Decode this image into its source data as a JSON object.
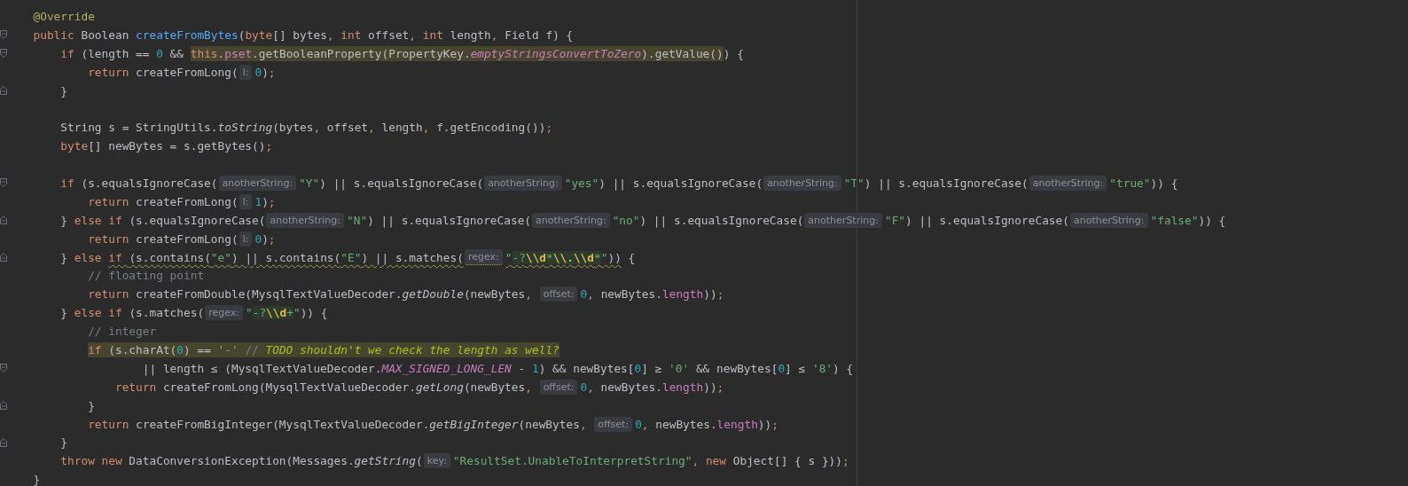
{
  "editor": {
    "lines": [
      {
        "kind": "code",
        "segs": [
          {
            "kind": "code",
            "tokens": [
              {
                "kind": "annotation",
                "text": "@Override"
              }
            ]
          }
        ]
      },
      {
        "kind": "code",
        "fold_start": true,
        "segs": [
          {
            "kind": "code",
            "tokens": [
              {
                "kind": "keyword",
                "text": "public "
              },
              {
                "kind": "plain",
                "text": "Boolean "
              },
              {
                "kind": "decl",
                "text": "createFromBytes"
              },
              {
                "kind": "plain",
                "text": "("
              },
              {
                "kind": "keyword",
                "text": "byte"
              },
              {
                "kind": "plain",
                "text": "[] bytes"
              },
              {
                "kind": "keyword",
                "text": ", int "
              },
              {
                "kind": "plain",
                "text": "offset"
              },
              {
                "kind": "keyword",
                "text": ", int "
              },
              {
                "kind": "plain",
                "text": "length"
              },
              {
                "kind": "keyword",
                "text": ", "
              },
              {
                "kind": "plain",
                "text": "Field f) {"
              }
            ]
          }
        ]
      },
      {
        "kind": "code",
        "fold_start": true,
        "segs": [
          {
            "kind": "code",
            "tokens": [
              {
                "kind": "keyword",
                "text": "    if "
              },
              {
                "kind": "plain",
                "text": "(length == "
              },
              {
                "kind": "number",
                "text": "0"
              },
              {
                "kind": "plain",
                "text": " && "
              }
            ]
          },
          {
            "kind": "match",
            "tokens": [
              {
                "kind": "keyword",
                "text": "this"
              },
              {
                "kind": "plain",
                "text": "."
              },
              {
                "kind": "field",
                "text": "pset"
              },
              {
                "kind": "plain",
                "text": ".getBooleanProperty(PropertyKey."
              },
              {
                "kind": "sfield",
                "text": "emptyStringsConvertToZero"
              },
              {
                "kind": "plain",
                "text": ").getValue()"
              }
            ]
          },
          {
            "kind": "code",
            "tokens": [
              {
                "kind": "plain",
                "text": ") {"
              }
            ]
          }
        ]
      },
      {
        "kind": "code",
        "segs": [
          {
            "kind": "code",
            "tokens": [
              {
                "kind": "keyword",
                "text": "        return "
              },
              {
                "kind": "plain",
                "text": "createFromLong("
              }
            ]
          },
          {
            "kind": "hint",
            "text": "l:"
          },
          {
            "kind": "code",
            "tokens": [
              {
                "kind": "number",
                "text": "0"
              },
              {
                "kind": "plain",
                "text": ")"
              },
              {
                "kind": "keyword",
                "text": ";"
              }
            ]
          }
        ]
      },
      {
        "kind": "code",
        "fold_end": true,
        "segs": [
          {
            "kind": "code",
            "tokens": [
              {
                "kind": "plain",
                "text": "    }"
              }
            ]
          }
        ]
      },
      {
        "kind": "blank"
      },
      {
        "kind": "code",
        "segs": [
          {
            "kind": "code",
            "tokens": [
              {
                "kind": "plain",
                "text": "    String s = StringUtils."
              },
              {
                "kind": "scall",
                "text": "toString"
              },
              {
                "kind": "plain",
                "text": "(bytes"
              },
              {
                "kind": "keyword",
                "text": ", "
              },
              {
                "kind": "plain",
                "text": "offset"
              },
              {
                "kind": "keyword",
                "text": ", "
              },
              {
                "kind": "plain",
                "text": "length"
              },
              {
                "kind": "keyword",
                "text": ", "
              },
              {
                "kind": "plain",
                "text": "f.getEncoding())"
              },
              {
                "kind": "keyword",
                "text": ";"
              }
            ]
          }
        ]
      },
      {
        "kind": "code",
        "segs": [
          {
            "kind": "code",
            "tokens": [
              {
                "kind": "keyword",
                "text": "    byte"
              },
              {
                "kind": "plain",
                "text": "[] newBytes = s.getBytes()"
              },
              {
                "kind": "keyword",
                "text": ";"
              }
            ]
          }
        ]
      },
      {
        "kind": "blank"
      },
      {
        "kind": "code",
        "fold_start": true,
        "segs": [
          {
            "kind": "code",
            "tokens": [
              {
                "kind": "keyword",
                "text": "    if "
              },
              {
                "kind": "plain",
                "text": "(s.equalsIgnoreCase("
              }
            ]
          },
          {
            "kind": "hint",
            "text": "anotherString:"
          },
          {
            "kind": "code",
            "tokens": [
              {
                "kind": "string",
                "text": "\"Y\""
              },
              {
                "kind": "plain",
                "text": ") || s.equalsIgnoreCase("
              }
            ]
          },
          {
            "kind": "hint",
            "text": "anotherString:"
          },
          {
            "kind": "code",
            "tokens": [
              {
                "kind": "string",
                "text": "\"yes\""
              },
              {
                "kind": "plain",
                "text": ") || s.equalsIgnoreCase("
              }
            ]
          },
          {
            "kind": "hint",
            "text": "anotherString:"
          },
          {
            "kind": "code",
            "tokens": [
              {
                "kind": "string",
                "text": "\"T\""
              },
              {
                "kind": "plain",
                "text": ") || s.equalsIgnoreCase("
              }
            ]
          },
          {
            "kind": "hint",
            "text": "anotherString:"
          },
          {
            "kind": "code",
            "tokens": [
              {
                "kind": "string",
                "text": "\"true\""
              },
              {
                "kind": "plain",
                "text": ")) {"
              }
            ]
          }
        ]
      },
      {
        "kind": "code",
        "segs": [
          {
            "kind": "code",
            "tokens": [
              {
                "kind": "keyword",
                "text": "        return "
              },
              {
                "kind": "plain",
                "text": "createFromLong("
              }
            ]
          },
          {
            "kind": "hint",
            "text": "l:"
          },
          {
            "kind": "code",
            "tokens": [
              {
                "kind": "number",
                "text": "1"
              },
              {
                "kind": "plain",
                "text": ")"
              },
              {
                "kind": "keyword",
                "text": ";"
              }
            ]
          }
        ]
      },
      {
        "kind": "code",
        "fold_end": true,
        "segs": [
          {
            "kind": "code",
            "tokens": [
              {
                "kind": "plain",
                "text": "    } "
              },
              {
                "kind": "keyword",
                "text": "else if "
              },
              {
                "kind": "plain",
                "text": "(s.equalsIgnoreCase("
              }
            ]
          },
          {
            "kind": "hint",
            "text": "anotherString:"
          },
          {
            "kind": "code",
            "tokens": [
              {
                "kind": "string",
                "text": "\"N\""
              },
              {
                "kind": "plain",
                "text": ") || s.equalsIgnoreCase("
              }
            ]
          },
          {
            "kind": "hint",
            "text": "anotherString:"
          },
          {
            "kind": "code",
            "tokens": [
              {
                "kind": "string",
                "text": "\"no\""
              },
              {
                "kind": "plain",
                "text": ") || s.equalsIgnoreCase("
              }
            ]
          },
          {
            "kind": "hint",
            "text": "anotherString:"
          },
          {
            "kind": "code",
            "tokens": [
              {
                "kind": "string",
                "text": "\"F\""
              },
              {
                "kind": "plain",
                "text": ") || s.equalsIgnoreCase("
              }
            ]
          },
          {
            "kind": "hint",
            "text": "anotherString:"
          },
          {
            "kind": "code",
            "tokens": [
              {
                "kind": "string",
                "text": "\"false\""
              },
              {
                "kind": "plain",
                "text": ")) {"
              }
            ]
          }
        ]
      },
      {
        "kind": "code",
        "segs": [
          {
            "kind": "code",
            "tokens": [
              {
                "kind": "keyword",
                "text": "        return "
              },
              {
                "kind": "plain",
                "text": "createFromLong("
              }
            ]
          },
          {
            "kind": "hint",
            "text": "l:"
          },
          {
            "kind": "code",
            "tokens": [
              {
                "kind": "number",
                "text": "0"
              },
              {
                "kind": "plain",
                "text": ")"
              },
              {
                "kind": "keyword",
                "text": ";"
              }
            ]
          }
        ]
      },
      {
        "kind": "code",
        "fold_end": true,
        "segs": [
          {
            "kind": "code",
            "tokens": [
              {
                "kind": "plain",
                "text": "    } "
              },
              {
                "kind": "keyword",
                "text": "else "
              }
            ]
          },
          {
            "kind": "code",
            "warning": true,
            "tokens": [
              {
                "kind": "keyword",
                "text": "if "
              },
              {
                "kind": "plain",
                "text": "(s.contains("
              },
              {
                "kind": "string",
                "text": "\"e\""
              },
              {
                "kind": "plain",
                "text": ") || s.contains("
              },
              {
                "kind": "string",
                "text": "\"E\""
              },
              {
                "kind": "plain",
                "text": ") || s.matches("
              }
            ]
          },
          {
            "kind": "hint",
            "warning": true,
            "text": "regex:"
          },
          {
            "kind": "code",
            "warning": true,
            "tokens": [
              {
                "kind": "string",
                "text": "\""
              },
              {
                "kind": "regex",
                "text": "-?"
              },
              {
                "kind": "escape",
                "text": "\\\\d"
              },
              {
                "kind": "regex",
                "text": "*"
              },
              {
                "kind": "escape",
                "text": "\\\\."
              },
              {
                "kind": "escape",
                "text": "\\\\d"
              },
              {
                "kind": "regex",
                "text": "*"
              },
              {
                "kind": "string",
                "text": "\""
              },
              {
                "kind": "plain",
                "text": "))"
              }
            ]
          },
          {
            "kind": "code",
            "tokens": [
              {
                "kind": "plain",
                "text": " {"
              }
            ]
          }
        ]
      },
      {
        "kind": "code",
        "segs": [
          {
            "kind": "code",
            "tokens": [
              {
                "kind": "comment",
                "text": "        // floating point"
              }
            ]
          }
        ]
      },
      {
        "kind": "code",
        "segs": [
          {
            "kind": "code",
            "tokens": [
              {
                "kind": "keyword",
                "text": "        return "
              },
              {
                "kind": "plain",
                "text": "createFromDouble(MysqlTextValueDecoder."
              },
              {
                "kind": "scall",
                "text": "getDouble"
              },
              {
                "kind": "plain",
                "text": "(newBytes"
              },
              {
                "kind": "keyword",
                "text": ", "
              }
            ]
          },
          {
            "kind": "hint",
            "text": "offset:"
          },
          {
            "kind": "code",
            "tokens": [
              {
                "kind": "number",
                "text": "0"
              },
              {
                "kind": "keyword",
                "text": ", "
              },
              {
                "kind": "plain",
                "text": "newBytes."
              },
              {
                "kind": "field",
                "text": "length"
              },
              {
                "kind": "plain",
                "text": "))"
              },
              {
                "kind": "keyword",
                "text": ";"
              }
            ]
          }
        ]
      },
      {
        "kind": "code",
        "segs": [
          {
            "kind": "code",
            "tokens": [
              {
                "kind": "plain",
                "text": "    } "
              },
              {
                "kind": "keyword",
                "text": "else if "
              },
              {
                "kind": "plain",
                "text": "(s.matches("
              }
            ]
          },
          {
            "kind": "hint",
            "text": "regex:"
          },
          {
            "kind": "code",
            "tokens": [
              {
                "kind": "string",
                "text": "\""
              },
              {
                "kind": "regex",
                "text": "-?"
              },
              {
                "kind": "escape",
                "text": "\\\\d"
              },
              {
                "kind": "regex",
                "text": "+"
              },
              {
                "kind": "string",
                "text": "\""
              },
              {
                "kind": "plain",
                "text": ")) {"
              }
            ]
          }
        ]
      },
      {
        "kind": "code",
        "segs": [
          {
            "kind": "code",
            "tokens": [
              {
                "kind": "comment",
                "text": "        // integer"
              }
            ]
          }
        ]
      },
      {
        "kind": "code",
        "segs": [
          {
            "kind": "match",
            "tokens": [
              {
                "kind": "keyword",
                "text": "        if "
              },
              {
                "kind": "plain",
                "text": "(s.charAt("
              },
              {
                "kind": "number",
                "text": "0"
              },
              {
                "kind": "plain",
                "text": ") == "
              },
              {
                "kind": "string",
                "text": "'-'"
              },
              {
                "kind": "comment",
                "text": " // "
              },
              {
                "kind": "todo",
                "text": "TODO shouldn't we check the length as well?"
              }
            ]
          }
        ]
      },
      {
        "kind": "code",
        "fold_start": true,
        "segs": [
          {
            "kind": "code",
            "tokens": [
              {
                "kind": "plain",
                "text": "                || length ≤ (MysqlTextValueDecoder."
              },
              {
                "kind": "sfield",
                "text": "MAX_SIGNED_LONG_LEN"
              },
              {
                "kind": "plain",
                "text": " - "
              },
              {
                "kind": "number",
                "text": "1"
              },
              {
                "kind": "plain",
                "text": ") && newBytes["
              },
              {
                "kind": "number",
                "text": "0"
              },
              {
                "kind": "plain",
                "text": "] ≥ "
              },
              {
                "kind": "string",
                "text": "'0'"
              },
              {
                "kind": "plain",
                "text": " && newBytes["
              },
              {
                "kind": "number",
                "text": "0"
              },
              {
                "kind": "plain",
                "text": "] ≤ "
              },
              {
                "kind": "string",
                "text": "'8'"
              },
              {
                "kind": "plain",
                "text": ") {"
              }
            ]
          }
        ]
      },
      {
        "kind": "code",
        "segs": [
          {
            "kind": "code",
            "tokens": [
              {
                "kind": "keyword",
                "text": "            return "
              },
              {
                "kind": "plain",
                "text": "createFromLong(MysqlTextValueDecoder."
              },
              {
                "kind": "scall",
                "text": "getLong"
              },
              {
                "kind": "plain",
                "text": "(newBytes"
              },
              {
                "kind": "keyword",
                "text": ", "
              }
            ]
          },
          {
            "kind": "hint",
            "text": "offset:"
          },
          {
            "kind": "code",
            "tokens": [
              {
                "kind": "number",
                "text": "0"
              },
              {
                "kind": "keyword",
                "text": ", "
              },
              {
                "kind": "plain",
                "text": "newBytes."
              },
              {
                "kind": "field",
                "text": "length"
              },
              {
                "kind": "plain",
                "text": "))"
              },
              {
                "kind": "keyword",
                "text": ";"
              }
            ]
          }
        ]
      },
      {
        "kind": "code",
        "fold_end": true,
        "segs": [
          {
            "kind": "code",
            "tokens": [
              {
                "kind": "plain",
                "text": "        }"
              }
            ]
          }
        ]
      },
      {
        "kind": "code",
        "segs": [
          {
            "kind": "code",
            "tokens": [
              {
                "kind": "keyword",
                "text": "        return "
              },
              {
                "kind": "plain",
                "text": "createFromBigInteger(MysqlTextValueDecoder."
              },
              {
                "kind": "scall",
                "text": "getBigInteger"
              },
              {
                "kind": "plain",
                "text": "(newBytes"
              },
              {
                "kind": "keyword",
                "text": ", "
              }
            ]
          },
          {
            "kind": "hint",
            "text": "offset:"
          },
          {
            "kind": "code",
            "tokens": [
              {
                "kind": "number",
                "text": "0"
              },
              {
                "kind": "keyword",
                "text": ", "
              },
              {
                "kind": "plain",
                "text": "newBytes."
              },
              {
                "kind": "field",
                "text": "length"
              },
              {
                "kind": "plain",
                "text": "))"
              },
              {
                "kind": "keyword",
                "text": ";"
              }
            ]
          }
        ]
      },
      {
        "kind": "code",
        "fold_end": true,
        "segs": [
          {
            "kind": "code",
            "tokens": [
              {
                "kind": "plain",
                "text": "    }"
              }
            ]
          }
        ]
      },
      {
        "kind": "code",
        "segs": [
          {
            "kind": "code",
            "tokens": [
              {
                "kind": "keyword",
                "text": "    throw new "
              },
              {
                "kind": "plain",
                "text": "DataConversionException(Messages."
              },
              {
                "kind": "scall",
                "text": "getString"
              },
              {
                "kind": "plain",
                "text": "("
              }
            ]
          },
          {
            "kind": "hint",
            "text": "key:"
          },
          {
            "kind": "code",
            "tokens": [
              {
                "kind": "string",
                "text": "\"ResultSet.UnableToInterpretString\""
              },
              {
                "kind": "keyword",
                "text": ", new "
              },
              {
                "kind": "plain",
                "text": "Object[] { s }))"
              },
              {
                "kind": "keyword",
                "text": ";"
              }
            ]
          }
        ]
      },
      {
        "kind": "code",
        "segs": [
          {
            "kind": "code",
            "tokens": [
              {
                "kind": "plain",
                "text": "}"
              }
            ]
          }
        ]
      }
    ]
  }
}
